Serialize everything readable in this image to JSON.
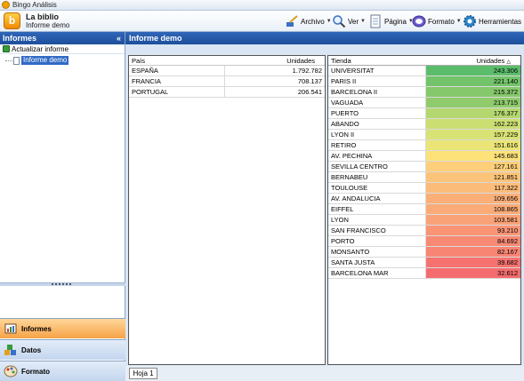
{
  "window": {
    "title": "Bingo Análisis"
  },
  "app": {
    "name": "La biblio",
    "subtitle": "Informe demo",
    "logo_letter": "b"
  },
  "menu": [
    {
      "label": "Archivo",
      "icon": "brush-icon"
    },
    {
      "label": "Ver",
      "icon": "magnifier-icon"
    },
    {
      "label": "Página",
      "icon": "page-icon"
    },
    {
      "label": "Formato",
      "icon": "format-icon"
    },
    {
      "label": "Herramientas",
      "icon": "gear-icon"
    }
  ],
  "sidebar": {
    "title": "Informes",
    "collapse_glyph": "«",
    "refresh_label": "Actualizar informe",
    "tree": [
      {
        "label": "Informe demo",
        "selected": true
      }
    ],
    "nav": [
      {
        "label": "Informes",
        "active": true
      },
      {
        "label": "Datos",
        "active": false
      },
      {
        "label": "Formato",
        "active": false
      }
    ]
  },
  "main": {
    "title": "Informe demo",
    "left_table": {
      "headers": [
        "País",
        "Unidades"
      ],
      "rows": [
        [
          "ESPAÑA",
          "1.792.782"
        ],
        [
          "FRANCIA",
          "708.137"
        ],
        [
          "PORTUGAL",
          "206.541"
        ]
      ]
    },
    "right_table": {
      "headers": [
        "Tienda",
        "Unidades"
      ],
      "sort_glyph": "△",
      "rows": [
        [
          "UNIVERSITAT",
          "243.306",
          "#5bbd6b"
        ],
        [
          "PARIS II",
          "221.140",
          "#72c36a"
        ],
        [
          "BARCELONA II",
          "215.372",
          "#85c86b"
        ],
        [
          "VAGUADA",
          "213.715",
          "#8fcb6c"
        ],
        [
          "PUERTO",
          "176.377",
          "#b4d76f"
        ],
        [
          "ABANDO",
          "162.223",
          "#cbde72"
        ],
        [
          "LYON II",
          "157.229",
          "#d9e274"
        ],
        [
          "RETIRO",
          "151.616",
          "#ebe577"
        ],
        [
          "AV. PECHINA",
          "145.683",
          "#fde27a"
        ],
        [
          "SEVILLA CENTRO",
          "127.161",
          "#fdcf7a"
        ],
        [
          "BERNABEU",
          "121.851",
          "#fcc47a"
        ],
        [
          "TOULOUSE",
          "117.322",
          "#fbbc79"
        ],
        [
          "AV. ANDALUCIA",
          "109.656",
          "#fbaf78"
        ],
        [
          "EIFFEL",
          "108.865",
          "#fbab78"
        ],
        [
          "LYON",
          "103.581",
          "#faa277"
        ],
        [
          "SAN FRANCISCO",
          "93.210",
          "#f99475"
        ],
        [
          "PORTO",
          "84.692",
          "#f88a74"
        ],
        [
          "MONSANTO",
          "82.167",
          "#f88573"
        ],
        [
          "SANTA JUSTA",
          "39.682",
          "#f67270"
        ],
        [
          "BARCELONA MAR",
          "32.612",
          "#f56c6e"
        ]
      ]
    },
    "sheet_tab": "Hoja 1"
  },
  "colors": {
    "accent": "#2f66b8",
    "nav_active": "#f7a347"
  }
}
